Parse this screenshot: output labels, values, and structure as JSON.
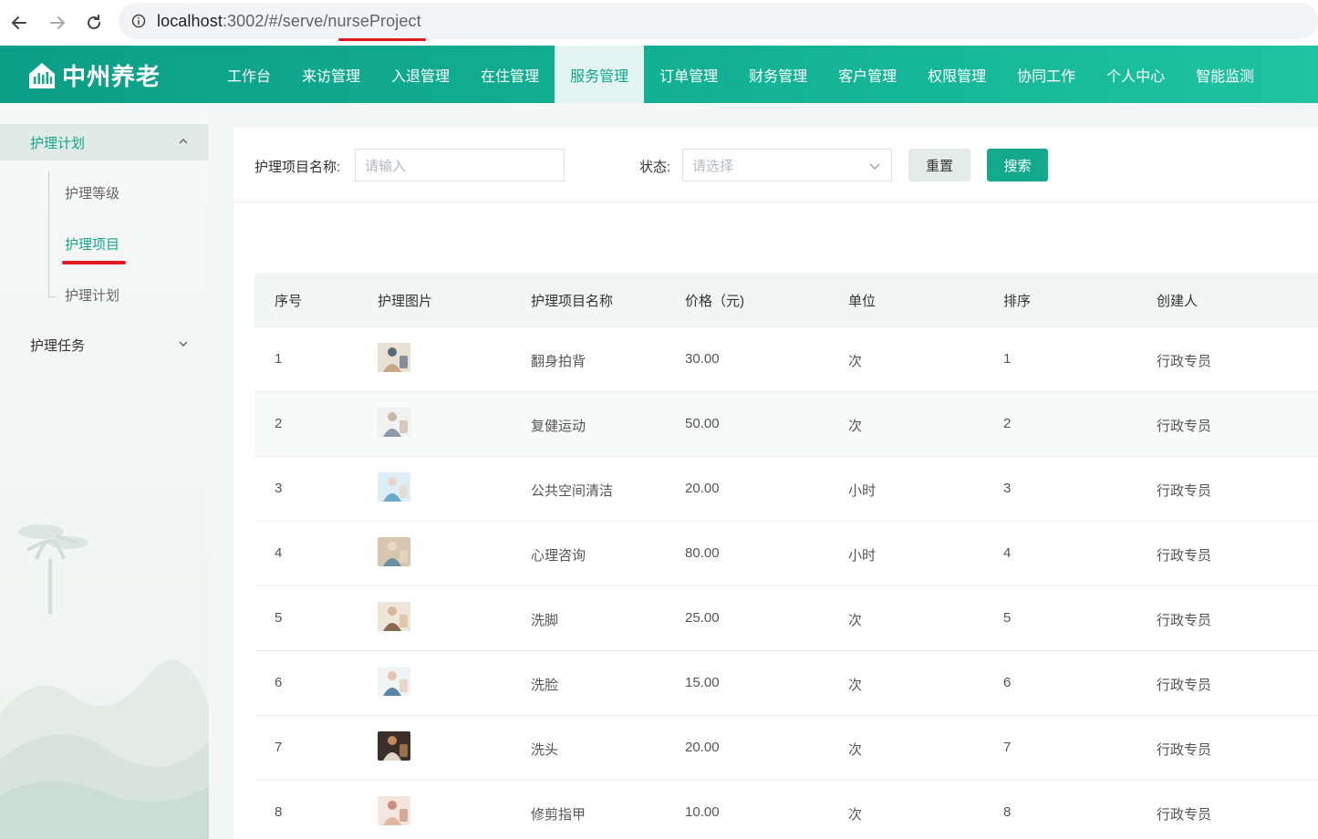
{
  "browser": {
    "url_host": "localhost",
    "url_path": ":3002/#/serve/nurseProject"
  },
  "app": {
    "logo_text": "中州养老",
    "nav": [
      "工作台",
      "来访管理",
      "入退管理",
      "在住管理",
      "服务管理",
      "订单管理",
      "财务管理",
      "客户管理",
      "权限管理",
      "协同工作",
      "个人中心",
      "智能监测"
    ],
    "active_nav": "服务管理",
    "accent": "#12a98c"
  },
  "sidebar": {
    "group_open": "护理计划",
    "sub_items": [
      "护理等级",
      "护理项目",
      "护理计划"
    ],
    "active_sub": "护理项目",
    "group_closed": "护理任务"
  },
  "search": {
    "name_label": "护理项目名称:",
    "name_placeholder": "请输入",
    "status_label": "状态:",
    "status_placeholder": "请选择",
    "reset_label": "重置",
    "search_label": "搜索"
  },
  "table": {
    "headers": [
      "序号",
      "护理图片",
      "护理项目名称",
      "价格（元)",
      "单位",
      "排序",
      "创建人"
    ],
    "rows": [
      {
        "no": "1",
        "image": "turn-over-pat-back-photo",
        "name": "翻身拍背",
        "price": "30.00",
        "unit": "次",
        "sort": "1",
        "creator": "行政专员"
      },
      {
        "no": "2",
        "image": "rehab-exercise-photo",
        "name": "复健运动",
        "price": "50.00",
        "unit": "次",
        "sort": "2",
        "creator": "行政专员"
      },
      {
        "no": "3",
        "image": "public-space-cleaning-photo",
        "name": "公共空间清洁",
        "price": "20.00",
        "unit": "小时",
        "sort": "3",
        "creator": "行政专员"
      },
      {
        "no": "4",
        "image": "psychological-counseling-photo",
        "name": "心理咨询",
        "price": "80.00",
        "unit": "小时",
        "sort": "4",
        "creator": "行政专员"
      },
      {
        "no": "5",
        "image": "foot-washing-photo",
        "name": "洗脚",
        "price": "25.00",
        "unit": "次",
        "sort": "5",
        "creator": "行政专员"
      },
      {
        "no": "6",
        "image": "face-washing-photo",
        "name": "洗脸",
        "price": "15.00",
        "unit": "次",
        "sort": "6",
        "creator": "行政专员"
      },
      {
        "no": "7",
        "image": "hair-washing-photo",
        "name": "洗头",
        "price": "20.00",
        "unit": "次",
        "sort": "7",
        "creator": "行政专员"
      },
      {
        "no": "8",
        "image": "nail-trimming-photo",
        "name": "修剪指甲",
        "price": "10.00",
        "unit": "次",
        "sort": "8",
        "creator": "行政专员"
      }
    ]
  }
}
